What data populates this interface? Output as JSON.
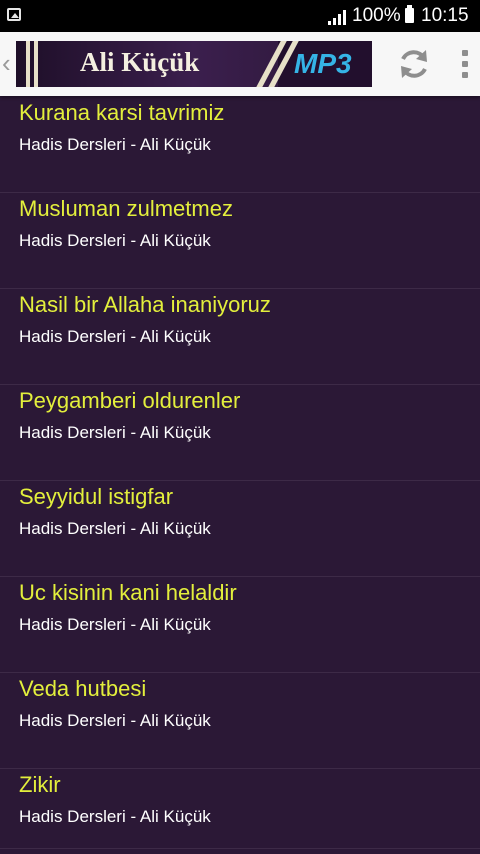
{
  "status_bar": {
    "battery_percent": "100%",
    "time": "10:15"
  },
  "action_bar": {
    "banner_title": "Ali Küçük",
    "banner_badge": "MP3"
  },
  "list": {
    "items": [
      {
        "title": "Kurana karsi tavrimiz",
        "subtitle": "Hadis Dersleri - Ali Küçük"
      },
      {
        "title": "Musluman zulmetmez",
        "subtitle": "Hadis Dersleri - Ali Küçük"
      },
      {
        "title": "Nasil bir Allaha inaniyoruz",
        "subtitle": "Hadis Dersleri - Ali Küçük"
      },
      {
        "title": "Peygamberi oldurenler",
        "subtitle": "Hadis Dersleri - Ali Küçük"
      },
      {
        "title": "Seyyidul istigfar",
        "subtitle": "Hadis Dersleri - Ali Küçük"
      },
      {
        "title": "Uc kisinin kani helaldir",
        "subtitle": "Hadis Dersleri - Ali Küçük"
      },
      {
        "title": "Veda hutbesi",
        "subtitle": "Hadis Dersleri - Ali Küçük"
      },
      {
        "title": "Zikir",
        "subtitle": "Hadis Dersleri - Ali Küçük"
      }
    ]
  },
  "colors": {
    "background": "#2b1836",
    "title_text": "#e3ef3c",
    "subtitle_text": "#ffffff"
  }
}
